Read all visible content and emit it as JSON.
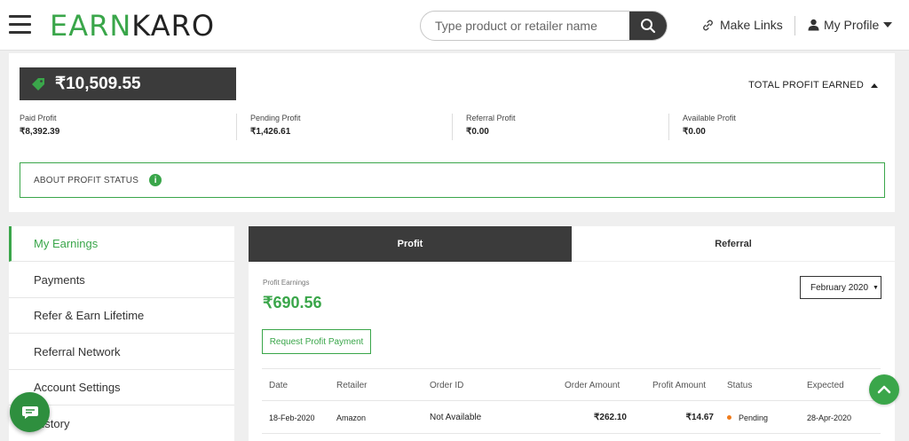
{
  "header": {
    "logo_part1": "EARN",
    "logo_part2": "KARO",
    "search_placeholder": "Type product or retailer name",
    "make_links": "Make Links",
    "my_profile": "My Profile"
  },
  "profit_summary": {
    "total_amount": "₹10,509.55",
    "total_label": "TOTAL PROFIT EARNED",
    "stats": [
      {
        "label": "Paid Profit",
        "value": "₹8,392.39"
      },
      {
        "label": "Pending Profit",
        "value": "₹1,426.61"
      },
      {
        "label": "Referral Profit",
        "value": "₹0.00"
      },
      {
        "label": "Available Profit",
        "value": "₹0.00"
      }
    ],
    "about_label": "ABOUT PROFIT STATUS",
    "about_icon": "i"
  },
  "sidebar": {
    "items": [
      {
        "label": "My Earnings",
        "active": true
      },
      {
        "label": "Payments"
      },
      {
        "label": "Refer & Earn Lifetime"
      },
      {
        "label": "Referral Network"
      },
      {
        "label": "Account Settings"
      },
      {
        "label": "History"
      }
    ]
  },
  "main": {
    "tabs": [
      {
        "label": "Profit",
        "active": true
      },
      {
        "label": "Referral"
      }
    ],
    "profit_earnings_label": "Profit Earnings",
    "profit_earnings_amount": "₹690.56",
    "month_selected": "February 2020",
    "month_caret": "▼",
    "request_button": "Request Profit Payment",
    "table": {
      "headers": [
        "Date",
        "Retailer",
        "Order ID",
        "Order Amount",
        "Profit Amount",
        "Status",
        "Expected"
      ],
      "rows": [
        {
          "date": "18-Feb-2020",
          "retailer": "Amazon",
          "order_id": "Not Available",
          "order_amount": "₹262.10",
          "profit_amount": "₹14.67",
          "status": "Pending",
          "expected": "28-Apr-2020"
        }
      ]
    }
  },
  "colors": {
    "brand_green": "#3aa64a",
    "dark": "#3b3b3b",
    "pending_orange": "#f07c1c"
  }
}
